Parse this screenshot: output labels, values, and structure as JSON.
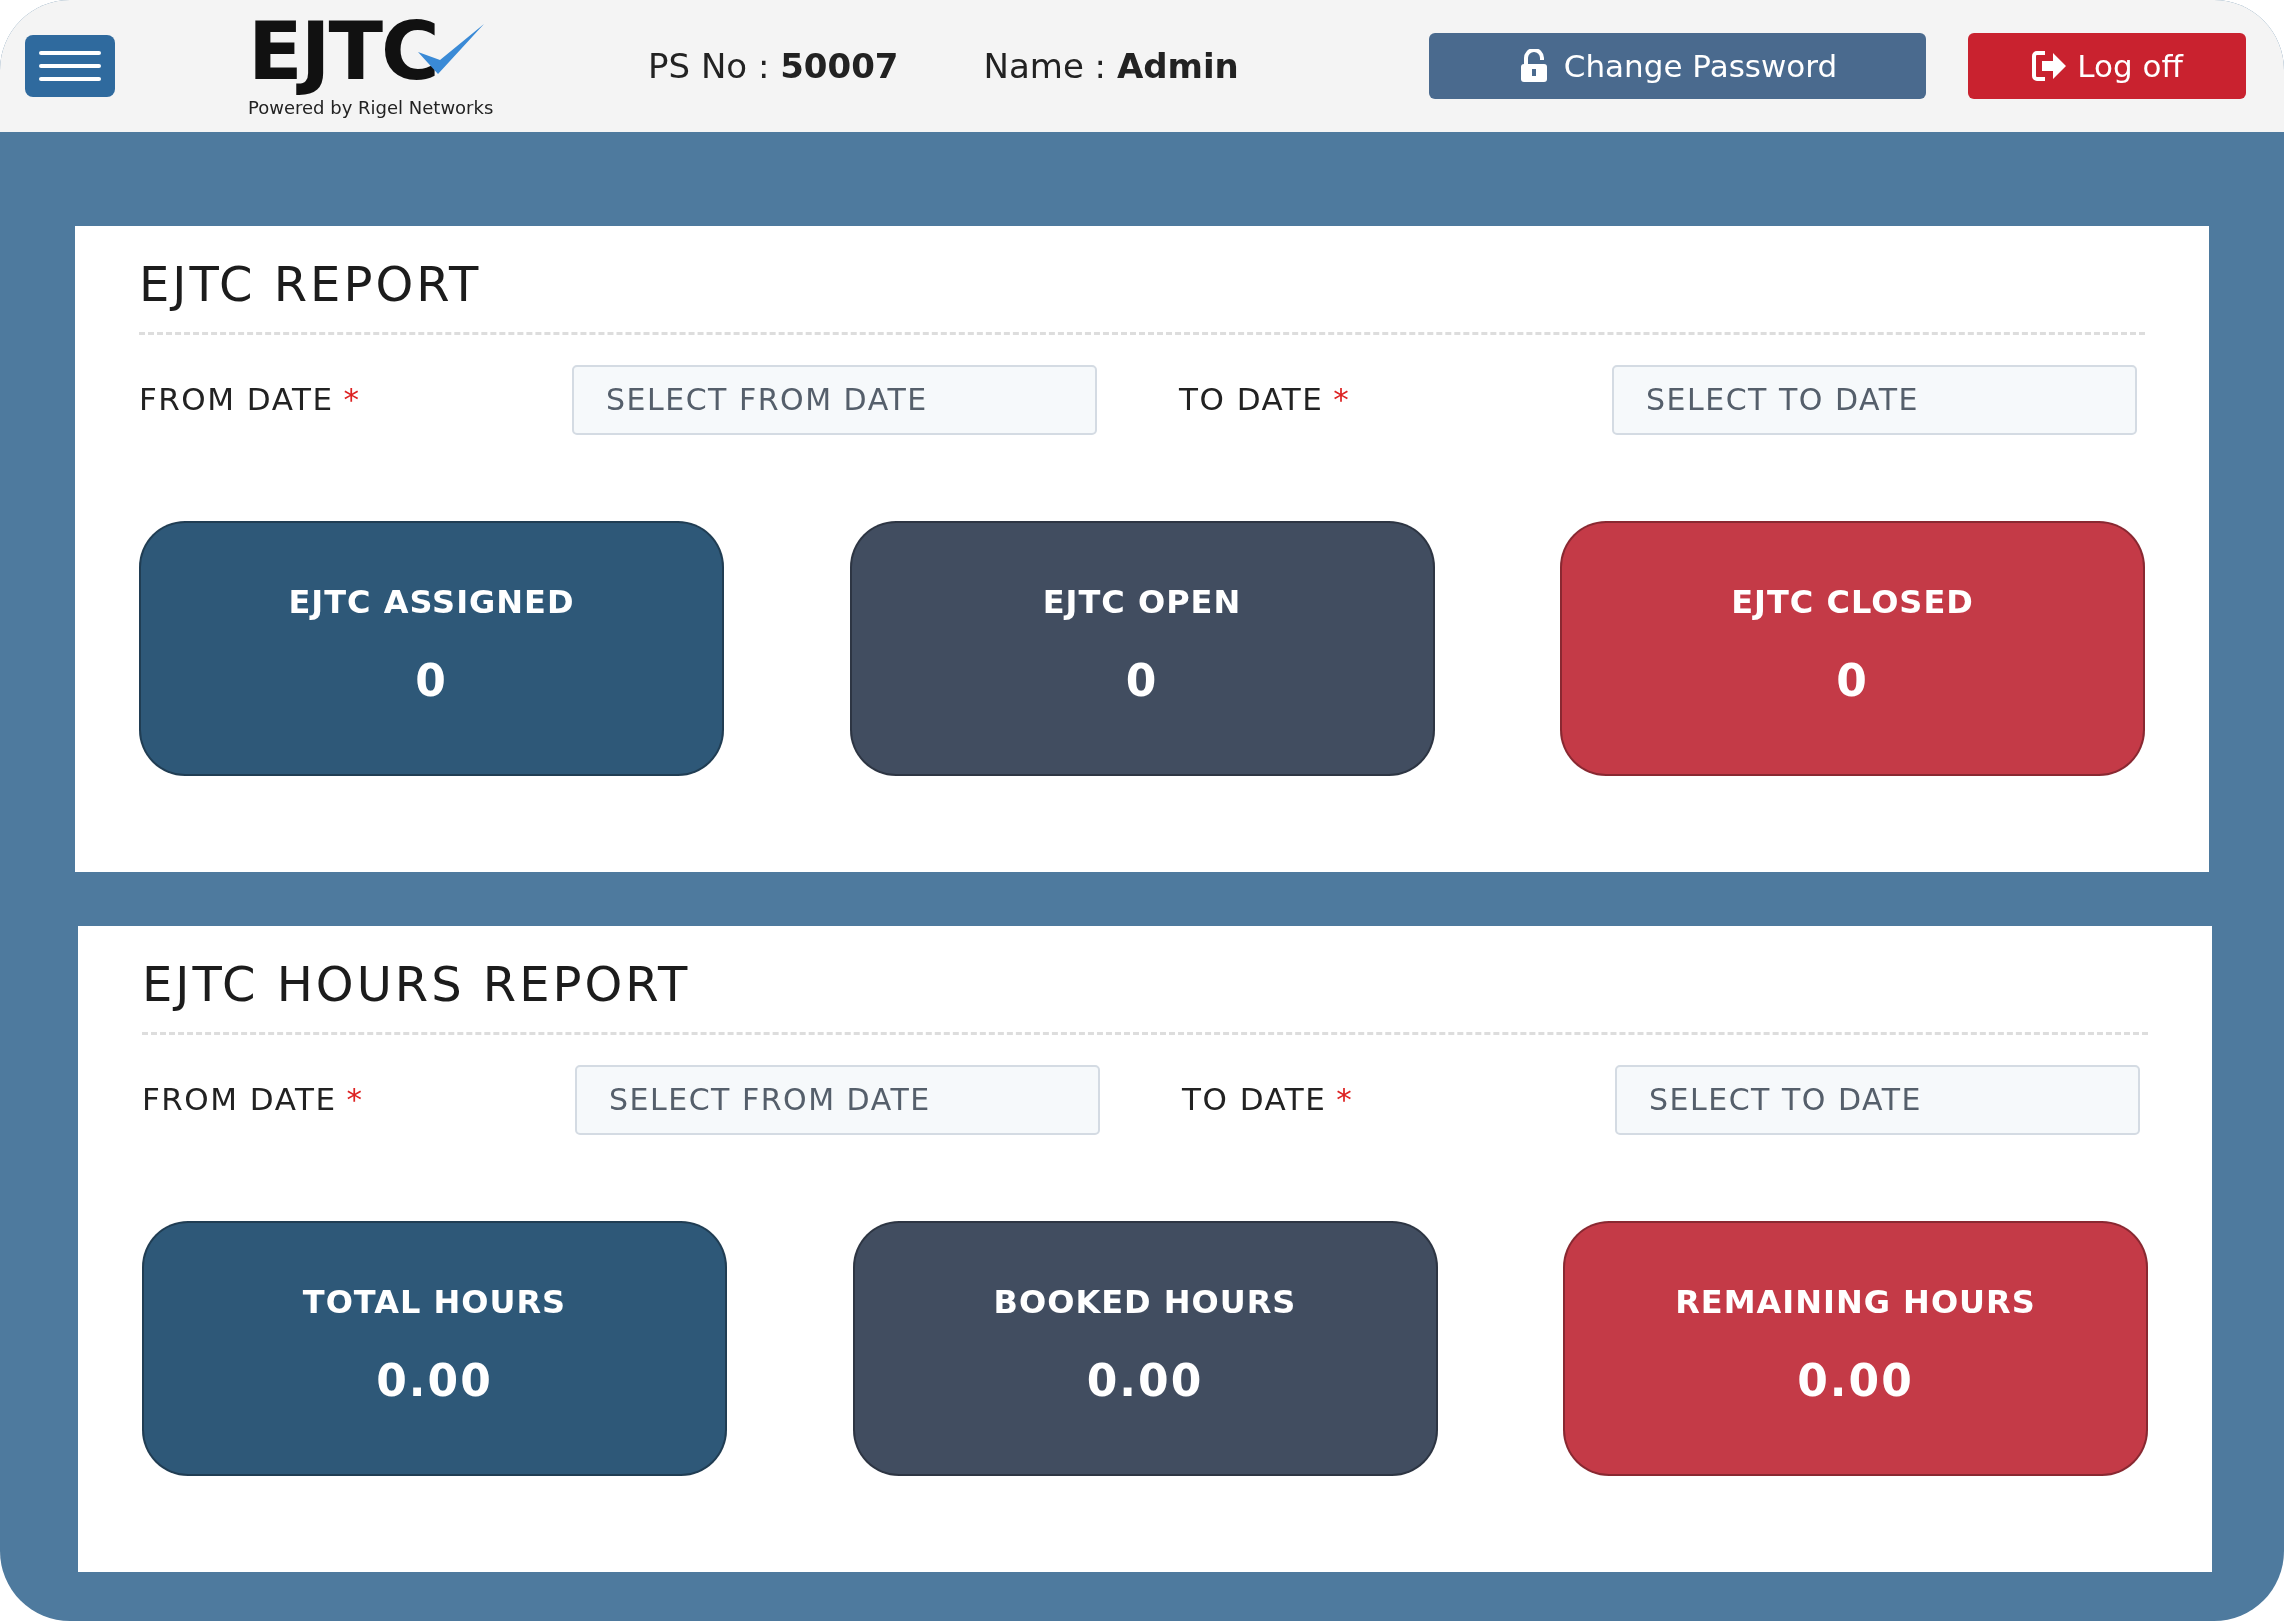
{
  "header": {
    "logo": {
      "text": "EJTC",
      "tagline": "Powered by Rigel Networks"
    },
    "ps": {
      "label": "PS No :",
      "value": "50007"
    },
    "user": {
      "label": "Name :",
      "value": "Admin"
    },
    "buttons": [
      {
        "kind": "password",
        "label": "Change Password"
      },
      {
        "kind": "logoff",
        "label": "Log off"
      }
    ]
  },
  "reports": [
    {
      "title": "EJTC REPORT",
      "fields": [
        {
          "label": "FROM DATE",
          "mark": "*",
          "placeholder": "SELECT FROM DATE"
        },
        {
          "label": "TO DATE",
          "mark": "*",
          "placeholder": "SELECT TO DATE"
        }
      ],
      "tiles": [
        {
          "label": "EJTC ASSIGNED",
          "value": "0",
          "color": "#2e5878"
        },
        {
          "label": "EJTC OPEN",
          "value": "0",
          "color": "#414d60"
        },
        {
          "label": "EJTC CLOSED",
          "value": "0",
          "color": "#c43a47"
        }
      ]
    },
    {
      "title": "EJTC HOURS REPORT",
      "fields": [
        {
          "label": "FROM DATE",
          "mark": "*",
          "placeholder": "SELECT FROM DATE"
        },
        {
          "label": "TO DATE",
          "mark": "*",
          "placeholder": "SELECT TO DATE"
        }
      ],
      "tiles": [
        {
          "label": "TOTAL HOURS",
          "value": "0.00",
          "color": "#2e5878"
        },
        {
          "label": "BOOKED HOURS",
          "value": "0.00",
          "color": "#414d60"
        },
        {
          "label": "REMAINING HOURS",
          "value": "0.00",
          "color": "#c43a47"
        }
      ]
    }
  ]
}
